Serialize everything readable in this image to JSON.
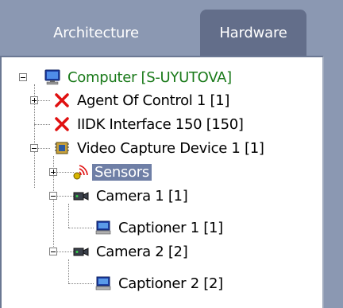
{
  "tabs": [
    {
      "label": "Architecture",
      "active": false
    },
    {
      "label": "Hardware",
      "active": true
    }
  ],
  "tree": {
    "computer": "Computer [S-UYUTOVA]",
    "agent": "Agent Of Control 1 [1]",
    "iidk": "IIDK Interface 150 [150]",
    "video": "Video Capture Device 1 [1]",
    "sensors": "Sensors",
    "camera1": "Camera 1 [1]",
    "captioner1": "Captioner 1 [1]",
    "camera2": "Camera 2 [2]",
    "captioner2": "Captioner 2 [2]"
  },
  "colors": {
    "tab_bar": "#8b98b2",
    "active_tab": "#636e8a",
    "selection": "#6f7fa6",
    "computer_label": "#1a7a1a",
    "error_x": "#e01010"
  }
}
